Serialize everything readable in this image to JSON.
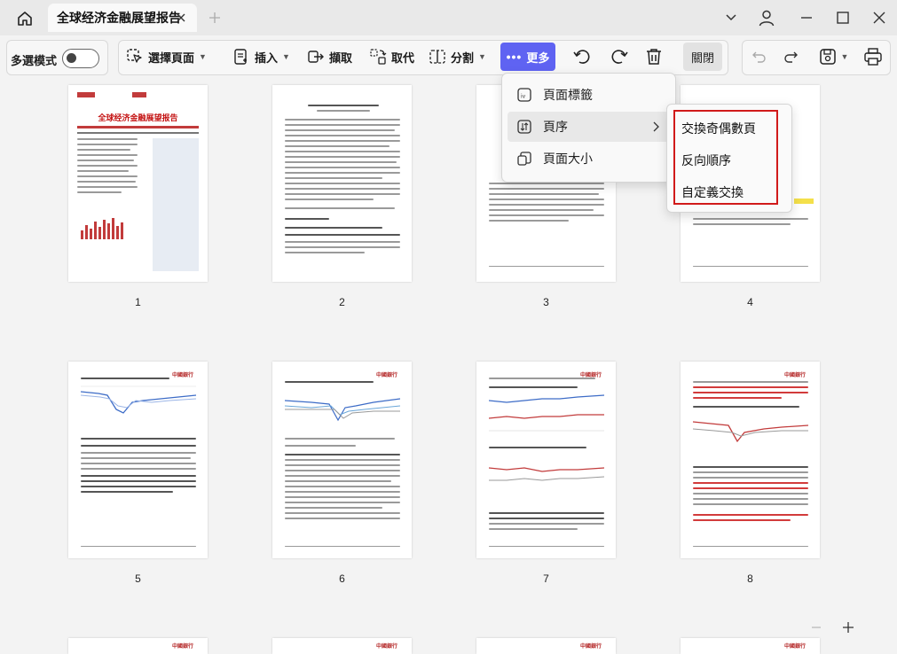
{
  "titlebar": {
    "tab_title": "全球经济金融展望报告"
  },
  "toolbar": {
    "multi_select_label": "多選模式",
    "select_page_label": "選擇頁面",
    "insert_label": "插入",
    "extract_label": "擷取",
    "replace_label": "取代",
    "split_label": "分割",
    "more_label": "更多",
    "close_label": "關閉"
  },
  "more_menu": {
    "items": [
      {
        "label": "頁面標籤",
        "icon": "page-label-icon"
      },
      {
        "label": "頁序",
        "icon": "page-order-icon"
      },
      {
        "label": "頁面大小",
        "icon": "page-size-icon"
      }
    ]
  },
  "page_order_submenu": {
    "items": [
      "交換奇偶數頁",
      "反向順序",
      "自定義交換"
    ]
  },
  "pages": {
    "p1": "1",
    "p2": "2",
    "p3": "3",
    "p4": "4",
    "p5": "5",
    "p6": "6",
    "p7": "7",
    "p8": "8"
  },
  "page1": {
    "title": "全球经济金融展望报告"
  },
  "colors": {
    "accent": "#5f63f2",
    "highlight_border": "#d11a1a"
  }
}
